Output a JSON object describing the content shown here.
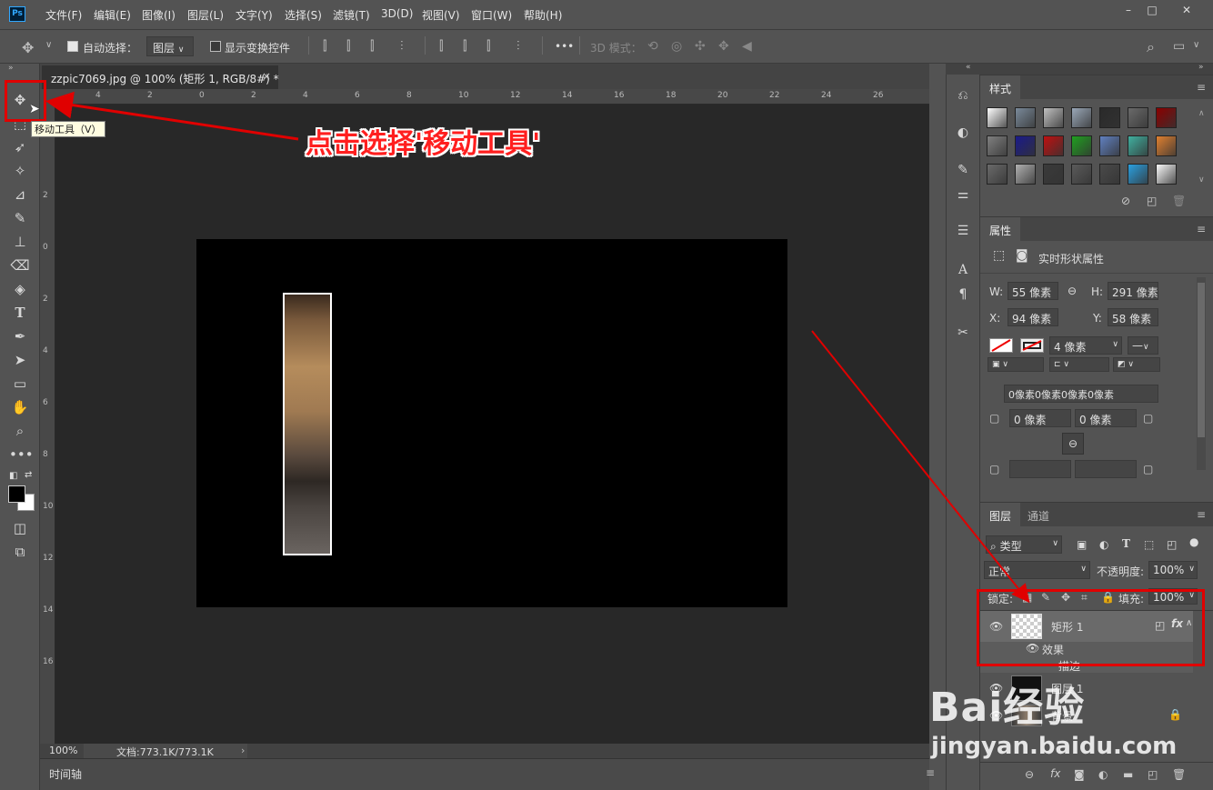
{
  "menu": {
    "logo": "Ps",
    "items": [
      "文件(F)",
      "编辑(E)",
      "图像(I)",
      "图层(L)",
      "文字(Y)",
      "选择(S)",
      "滤镜(T)",
      "3D(D)",
      "视图(V)",
      "窗口(W)",
      "帮助(H)"
    ],
    "minimize": "–",
    "maximize": "□",
    "close": "✕"
  },
  "options": {
    "auto_select_label": "自动选择：",
    "auto_select_target": "图层",
    "transform_controls_label": "显示变换控件",
    "more": "•••",
    "mode3d_label": "3D 模式："
  },
  "document": {
    "tab_title": "zzpic7069.jpg @ 100% (矩形 1, RGB/8#) *",
    "tab_close": "×",
    "zoom": "100%",
    "doc_size": "文档:773.1K/773.1K",
    "timeline_tab": "时间轴",
    "ruler_top_ticks": [
      "4",
      "2",
      "0",
      "2",
      "4",
      "6",
      "8",
      "10",
      "12",
      "14",
      "16",
      "18",
      "20",
      "22",
      "24",
      "26"
    ],
    "ruler_left_ticks": [
      "2",
      "0",
      "2",
      "4",
      "6",
      "8",
      "10",
      "12",
      "14",
      "16"
    ]
  },
  "tooltip": "移动工具（V）",
  "callout": "点击选择'移动工具'",
  "styles_panel": {
    "tab": "样式",
    "swatch_colors": [
      [
        "#ffffff",
        "#7a8a9a",
        "#c0c0c0",
        "#9aa8b8",
        "#2a2a2a",
        "#6a6a6a",
        "#8b0000"
      ],
      [
        "#808080",
        "#1a1a8a",
        "#c01010",
        "#20a020",
        "#6080c0",
        "#40b0a0",
        "#e08030"
      ],
      [
        "#6a6a6a",
        "#b0b0b0",
        "#3a3a3a",
        "#5a5a5a",
        "#4a4a4a",
        "#2aa0e0",
        "#f8f8f8"
      ]
    ]
  },
  "properties_panel": {
    "tab": "属性",
    "title": "实时形状属性",
    "w_label": "W:",
    "w_value": "55 像素",
    "h_label": "H:",
    "h_value": "291 像素",
    "x_label": "X:",
    "x_value": "94 像素",
    "y_label": "Y:",
    "y_value": "58 像素",
    "stroke_width": "4 像素",
    "corners_all": "0像素0像素0像素0像素",
    "corner_1": "0 像素",
    "corner_2": "0 像素"
  },
  "layers_panel": {
    "tabs": [
      "图层",
      "通道"
    ],
    "filter_kind": "类型",
    "blend_mode": "正常",
    "opacity_label": "不透明度:",
    "opacity_value": "100%",
    "lock_label": "锁定:",
    "fill_label": "填充:",
    "fill_value": "100%",
    "layers": [
      {
        "name": "矩形 1",
        "effects_label": "效果",
        "effect": "描边"
      },
      {
        "name": "图层 1"
      },
      {
        "name": "背景"
      }
    ]
  },
  "watermark": {
    "text": "Bai经验",
    "url": "jingyan.baidu.com"
  }
}
